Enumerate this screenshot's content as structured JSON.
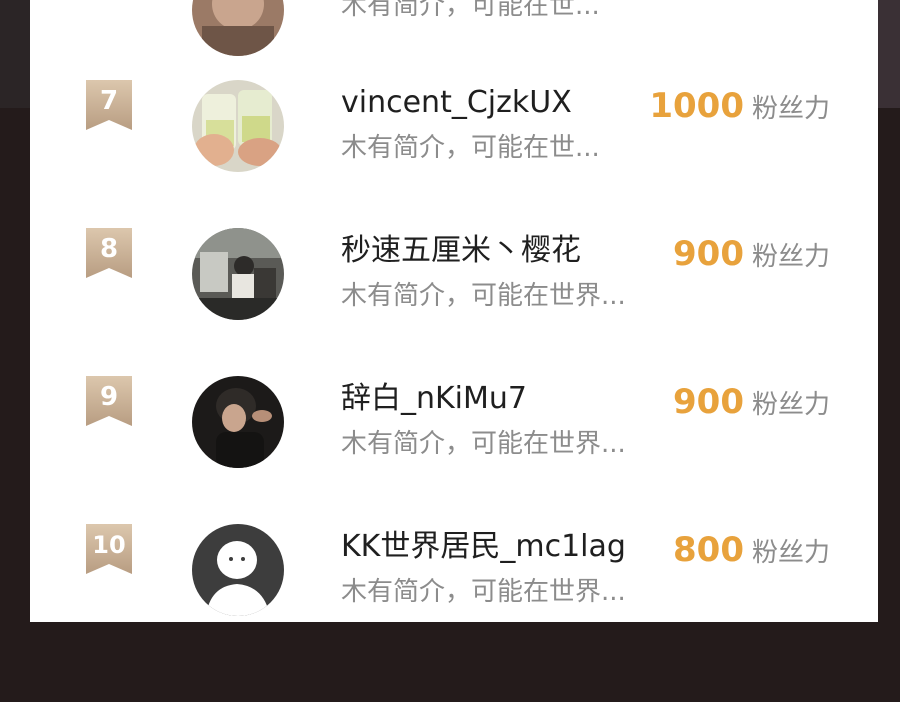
{
  "rank_list": {
    "fans_unit": "粉丝力",
    "partial_top_row": {
      "bio": "木有简介，可能在世..."
    },
    "rows": [
      {
        "rank": "7",
        "name": "vincent_CjzkUX",
        "bio": "木有简介，可能在世...",
        "fans": "1000"
      },
      {
        "rank": "8",
        "name": "秒速五厘米丶樱花",
        "bio": "木有简介，可能在世界...",
        "fans": "900"
      },
      {
        "rank": "9",
        "name": "辞白_nKiMu7",
        "bio": "木有简介，可能在世界...",
        "fans": "900"
      },
      {
        "rank": "10",
        "name": "KK世界居民_mc1lag",
        "bio": "木有简介，可能在世界...",
        "fans": "800"
      }
    ]
  },
  "colors": {
    "fans_value": "#e8a23c",
    "badge_light": "#d9c3a8",
    "badge_dark": "#b79c80",
    "name": "#1f1f1f",
    "muted": "#8c8c8c"
  },
  "icons": {
    "rank_badge": "ribbon-badge-icon",
    "default_avatar": "person-silhouette-icon"
  }
}
